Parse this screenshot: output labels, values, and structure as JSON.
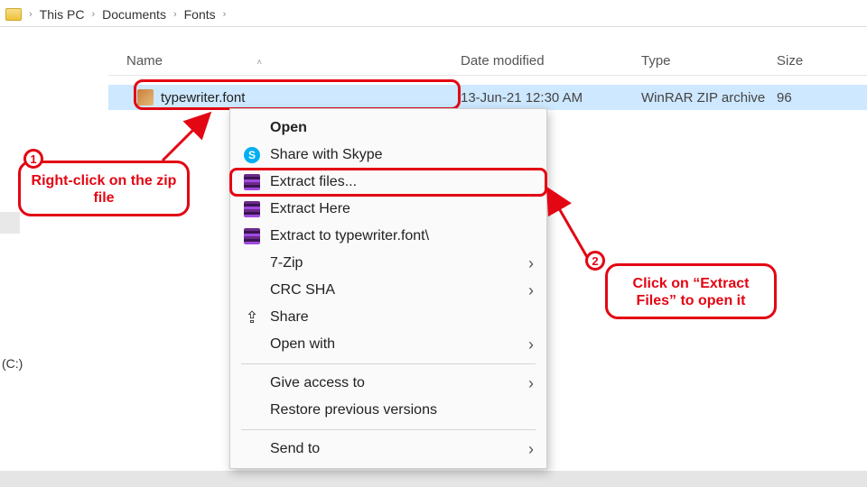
{
  "breadcrumb": {
    "items": [
      "This PC",
      "Documents",
      "Fonts"
    ]
  },
  "columns": {
    "name": "Name",
    "date": "Date modified",
    "type": "Type",
    "size": "Size"
  },
  "file": {
    "name": "typewriter.font",
    "date": "13-Jun-21 12:30 AM",
    "type": "WinRAR ZIP archive",
    "size": "96"
  },
  "sidebar": {
    "drive_hint": "(C:)"
  },
  "context_menu": {
    "open": "Open",
    "share_skype": "Share with Skype",
    "extract_files": "Extract files...",
    "extract_here": "Extract Here",
    "extract_to": "Extract to typewriter.font\\",
    "seven_zip": "7-Zip",
    "crc_sha": "CRC SHA",
    "share": "Share",
    "open_with": "Open with",
    "give_access": "Give access to",
    "restore": "Restore previous versions",
    "send_to": "Send to"
  },
  "callouts": {
    "c1_num": "1",
    "c1_text": "Right-click on the zip file",
    "c2_num": "2",
    "c2_text": "Click on “Extract Files” to open it"
  }
}
